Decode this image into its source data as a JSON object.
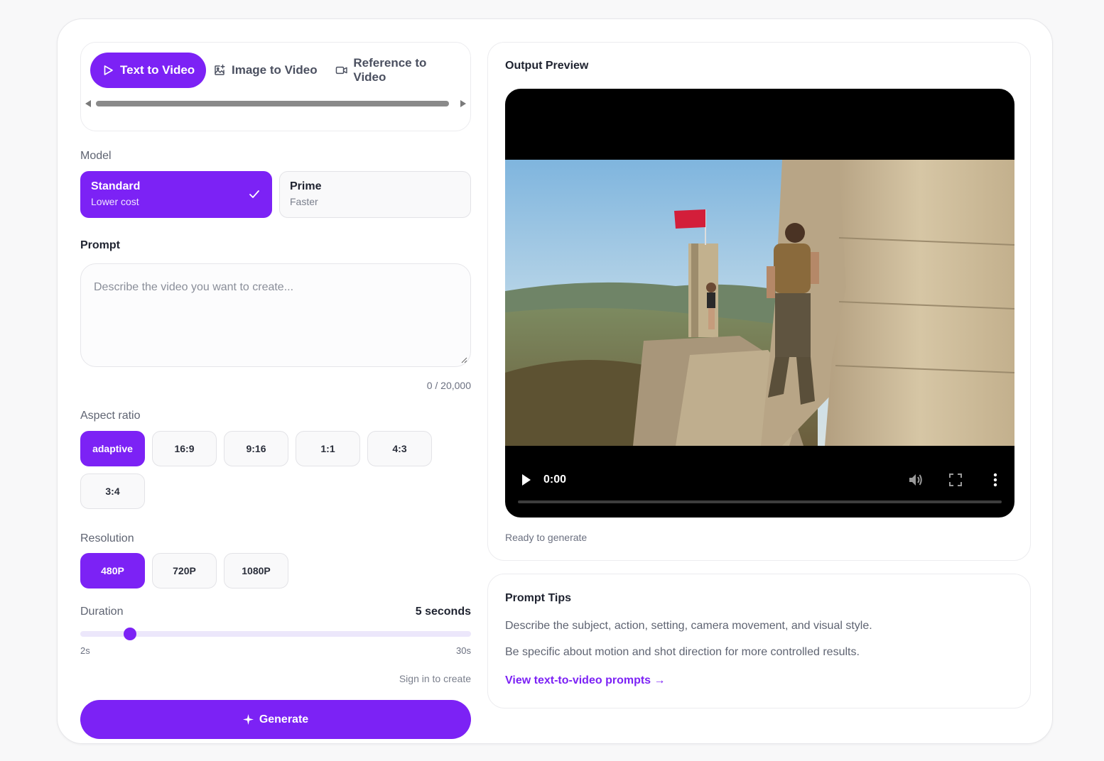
{
  "tabs": [
    {
      "label": "Text to Video",
      "icon": "play-outline-icon",
      "active": true
    },
    {
      "label": "Image to Video",
      "icon": "image-plus-icon",
      "active": false
    },
    {
      "label": "Reference to Video",
      "icon": "video-camera-icon",
      "active": false
    }
  ],
  "model": {
    "label": "Model",
    "options": [
      {
        "title": "Standard",
        "subtitle": "Lower cost",
        "selected": true
      },
      {
        "title": "Prime",
        "subtitle": "Faster",
        "selected": false
      }
    ]
  },
  "prompt": {
    "label": "Prompt",
    "placeholder": "Describe the video you want to create...",
    "value": "",
    "counter": "0 / 20,000"
  },
  "aspect_ratio": {
    "label": "Aspect ratio",
    "options": [
      "adaptive",
      "16:9",
      "9:16",
      "1:1",
      "4:3",
      "3:4"
    ],
    "selected": "adaptive"
  },
  "resolution": {
    "label": "Resolution",
    "options": [
      "480P",
      "720P",
      "1080P"
    ],
    "selected": "480P"
  },
  "duration": {
    "label": "Duration",
    "value_text": "5 seconds",
    "min_label": "2s",
    "max_label": "30s",
    "value": 5,
    "min": 2,
    "max": 30
  },
  "signin_text": "Sign in to create",
  "generate_label": "Generate",
  "preview": {
    "title": "Output Preview",
    "time": "0:00",
    "status": "Ready to generate"
  },
  "tips": {
    "title": "Prompt Tips",
    "lines": [
      "Describe the subject, action, setting, camera movement, and visual style.",
      "Be specific about motion and shot direction for more controlled results."
    ],
    "link": "View text-to-video prompts →"
  },
  "colors": {
    "accent": "#7c22f5",
    "video_bg": "#000000"
  }
}
